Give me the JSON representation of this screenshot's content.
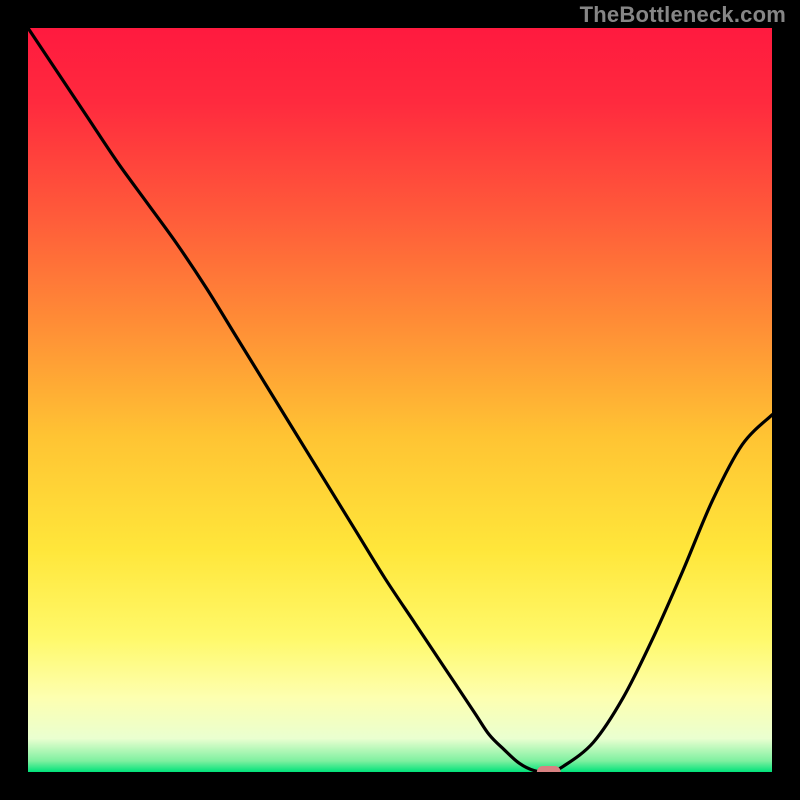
{
  "watermark": "TheBottleneck.com",
  "chart_data": {
    "type": "line",
    "title": "",
    "xlabel": "",
    "ylabel": "",
    "xlim": [
      0,
      100
    ],
    "ylim": [
      0,
      100
    ],
    "grid": false,
    "legend": false,
    "background_gradient_stops": [
      {
        "offset": 0.0,
        "color": "#ff1a3f"
      },
      {
        "offset": 0.1,
        "color": "#ff2a3e"
      },
      {
        "offset": 0.25,
        "color": "#ff5a3a"
      },
      {
        "offset": 0.4,
        "color": "#ff8e36"
      },
      {
        "offset": 0.55,
        "color": "#ffc433"
      },
      {
        "offset": 0.7,
        "color": "#ffe63a"
      },
      {
        "offset": 0.82,
        "color": "#fff96a"
      },
      {
        "offset": 0.9,
        "color": "#fdffb0"
      },
      {
        "offset": 0.955,
        "color": "#eaffd0"
      },
      {
        "offset": 0.985,
        "color": "#7ff0a0"
      },
      {
        "offset": 1.0,
        "color": "#00e27a"
      }
    ],
    "series": [
      {
        "name": "curve",
        "color": "#000000",
        "x": [
          0,
          4,
          8,
          12,
          16,
          20,
          24,
          28,
          32,
          36,
          40,
          44,
          48,
          52,
          56,
          60,
          62,
          64,
          66,
          68,
          70,
          72,
          76,
          80,
          84,
          88,
          92,
          96,
          100
        ],
        "y": [
          100,
          94,
          88,
          82,
          76.5,
          71,
          65,
          58.5,
          52,
          45.5,
          39,
          32.5,
          26,
          20,
          14,
          8,
          5,
          3,
          1.2,
          0.2,
          0,
          0.8,
          4,
          10,
          18,
          27,
          36.5,
          44,
          48
        ]
      }
    ],
    "marker": {
      "name": "selected-point",
      "x": 70,
      "y": 0,
      "color": "#d98282",
      "width": 3.2,
      "height": 1.6
    }
  }
}
